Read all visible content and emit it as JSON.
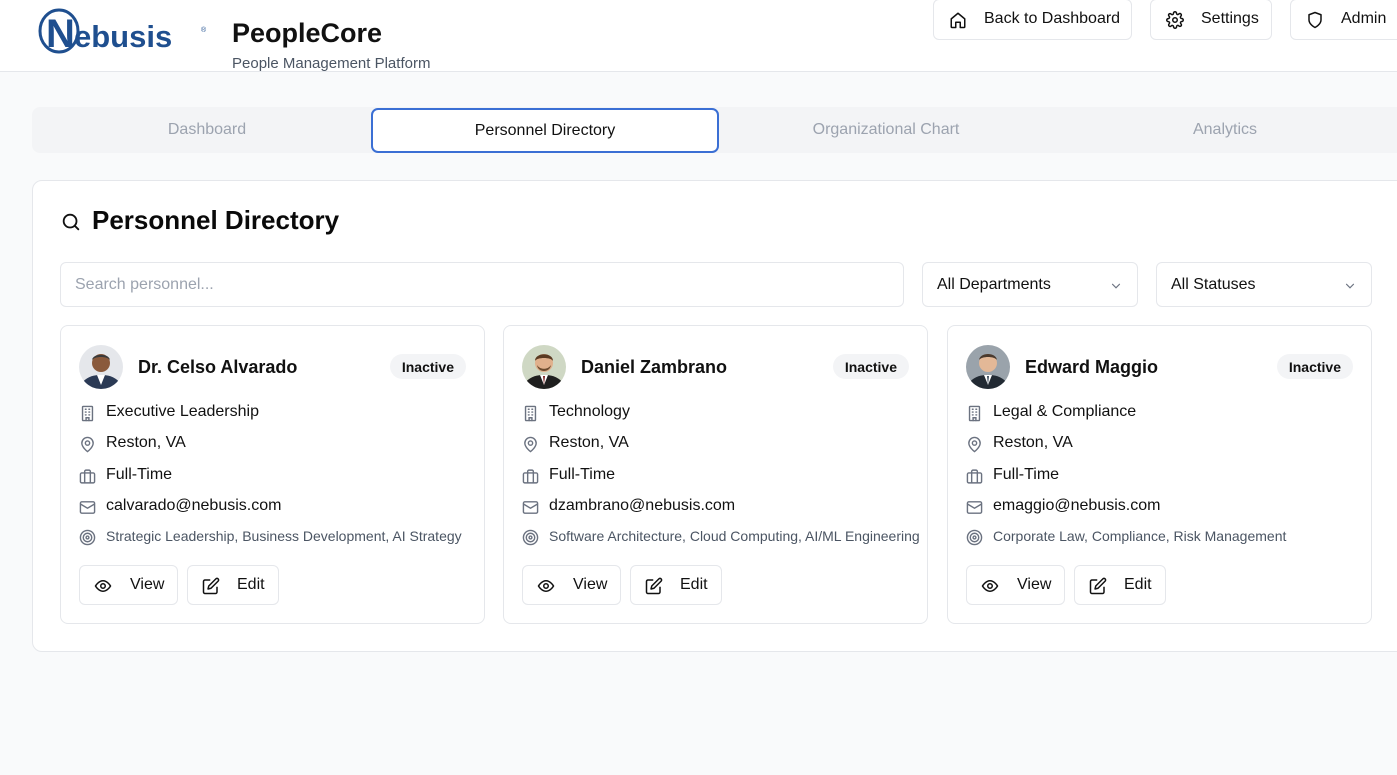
{
  "header": {
    "logo_text": "Nebusis",
    "app_title": "PeopleCore",
    "app_subtitle": "People Management Platform",
    "back_label": "Back to Dashboard",
    "settings_label": "Settings",
    "admin_label": "Admin"
  },
  "tabs": [
    {
      "label": "Dashboard",
      "active": false
    },
    {
      "label": "Personnel Directory",
      "active": true
    },
    {
      "label": "Organizational Chart",
      "active": false
    },
    {
      "label": "Analytics",
      "active": false
    }
  ],
  "directory": {
    "title": "Personnel Directory",
    "search_placeholder": "Search personnel...",
    "department_filter": "All Departments",
    "status_filter": "All Statuses"
  },
  "people": [
    {
      "name": "Dr. Celso Alvarado",
      "status": "Inactive",
      "department": "Executive Leadership",
      "location": "Reston, VA",
      "employment": "Full-Time",
      "email": "calvarado@nebusis.com",
      "skills": "Strategic Leadership, Business Development, AI Strategy",
      "view_label": "View",
      "edit_label": "Edit"
    },
    {
      "name": "Daniel Zambrano",
      "status": "Inactive",
      "department": "Technology",
      "location": "Reston, VA",
      "employment": "Full-Time",
      "email": "dzambrano@nebusis.com",
      "skills": "Software Architecture, Cloud Computing, AI/ML Engineering",
      "view_label": "View",
      "edit_label": "Edit"
    },
    {
      "name": "Edward Maggio",
      "status": "Inactive",
      "department": "Legal & Compliance",
      "location": "Reston, VA",
      "employment": "Full-Time",
      "email": "emaggio@nebusis.com",
      "skills": "Corporate Law, Compliance, Risk Management",
      "view_label": "View",
      "edit_label": "Edit"
    }
  ],
  "colors": {
    "brand_blue": "#1f4f8f",
    "active_tab_border": "#3b6fd4",
    "badge_bg": "#f3f4f6",
    "border": "#e5e7eb"
  },
  "icons": {
    "back": "home-icon",
    "settings": "gear-icon",
    "admin": "shield-icon",
    "title": "search-icon",
    "select": "chevron-down-icon",
    "department": "building-icon",
    "location": "map-pin-icon",
    "employment": "briefcase-icon",
    "email": "mail-icon",
    "skills": "target-icon",
    "view": "eye-icon",
    "edit": "edit-icon"
  }
}
